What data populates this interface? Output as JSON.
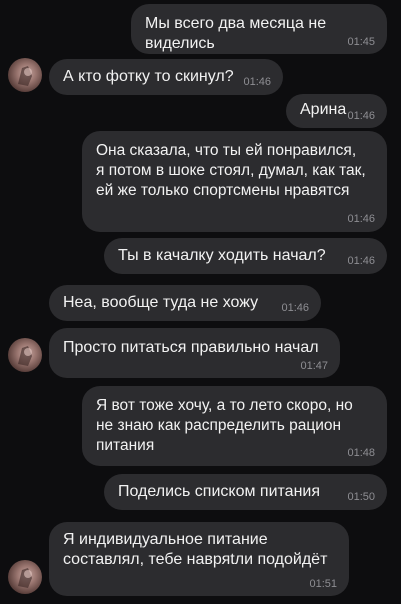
{
  "messages": [
    {
      "side": "out",
      "text": "Мы всего два месяца не виделись",
      "time": "01:45"
    },
    {
      "side": "in",
      "text": "А кто фотку то скинул?",
      "time": "01:46",
      "avatar": true
    },
    {
      "side": "out",
      "text": "Арина",
      "time": "01:46"
    },
    {
      "side": "out",
      "text": "Она сказала, что ты ей понравился, я потом в шоке стоял, думал, как так, ей же только спортсмены нравятся",
      "time": "01:46"
    },
    {
      "side": "out",
      "text": "Ты в качалку ходить начал?",
      "time": "01:46"
    },
    {
      "side": "in",
      "text": "Неа, вообще туда не хожу",
      "time": "01:46"
    },
    {
      "side": "in",
      "text": "Просто питаться правильно начал",
      "time": "01:47",
      "avatar": true
    },
    {
      "side": "out",
      "text": "Я вот тоже хочу, а то лето скоро, но не знаю как распределить рацион питания",
      "time": "01:48"
    },
    {
      "side": "out",
      "text": "Поделись списком питания",
      "time": "01:50"
    },
    {
      "side": "in",
      "text": "Я индивидуальное питание составлял, тебе навряtли подойдёт",
      "time": "01:51",
      "avatar": true
    }
  ],
  "colors": {
    "background": "#0d0d0f",
    "bubble": "#2c2c2f",
    "time": "#8e8e93"
  },
  "icons": {
    "avatar": "contact-avatar-icon"
  }
}
